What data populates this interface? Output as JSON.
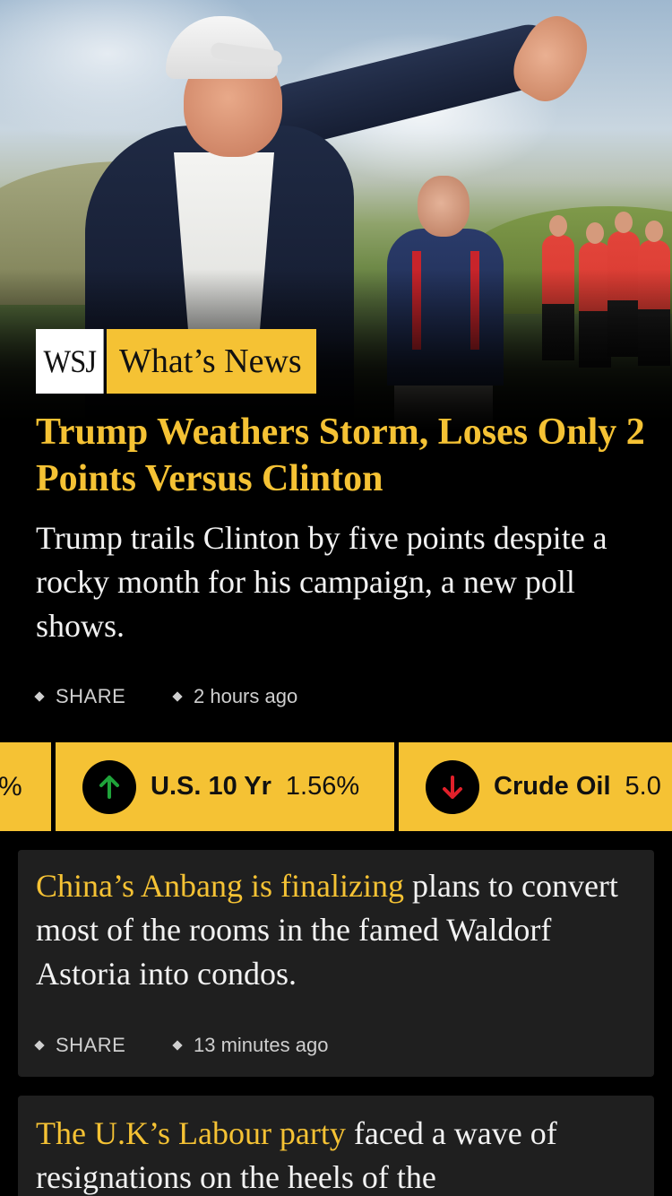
{
  "brand": {
    "logo": "WSJ",
    "section": "What’s News"
  },
  "hero": {
    "image": "campaign-photo",
    "headline": "Trump Weathers Storm, Loses Only 2 Points Versus Clinton",
    "dek": "Trump trails Clinton by five points despite a rocky month for his campaign, a new poll shows.",
    "share_label": "SHARE",
    "time": "2 hours ago"
  },
  "ticker": [
    {
      "partial_value": "%"
    },
    {
      "name": "U.S. 10 Yr",
      "value": "1.56%",
      "direction": "up",
      "arrow_icon": "arrow-up-icon",
      "color": "#1fa33a"
    },
    {
      "name": "Crude Oil",
      "value": "5.0",
      "direction": "down",
      "arrow_icon": "arrow-down-icon",
      "color": "#e0202a"
    }
  ],
  "stories": [
    {
      "highlight": "China’s Anbang is finalizing",
      "rest": " plans to convert most of the rooms in the famed Waldorf Astoria into condos.",
      "share_label": "SHARE",
      "time": "13 minutes ago"
    },
    {
      "highlight": "The U.K’s Labour party",
      "rest": " faced a wave of resignations on the heels of the"
    }
  ],
  "colors": {
    "accent": "#f5c234",
    "background": "#000000",
    "card": "#1f1f1f"
  }
}
